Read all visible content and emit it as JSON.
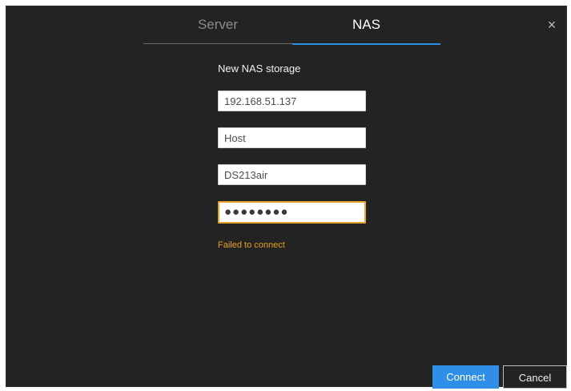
{
  "tabs": [
    {
      "label": "Server",
      "active": false
    },
    {
      "label": "NAS",
      "active": true
    }
  ],
  "close_icon": "×",
  "form": {
    "title": "New NAS storage",
    "ip_value": "192.168.51.137",
    "host_placeholder": "Host",
    "username_value": "DS213air",
    "password_masked": "●●●●●●●●",
    "error_message": "Failed to connect"
  },
  "buttons": {
    "connect": "Connect",
    "cancel": "Cancel"
  },
  "colors": {
    "background": "#232323",
    "accent": "#2f8fe8",
    "warning": "#e8a21a"
  }
}
